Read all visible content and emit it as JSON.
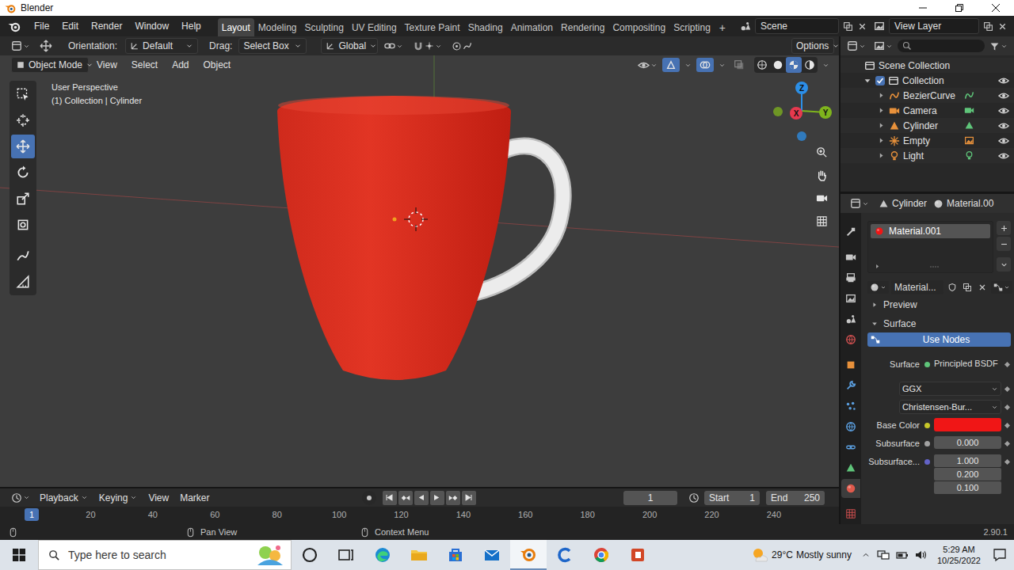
{
  "window": {
    "title": "Blender"
  },
  "menu": [
    "File",
    "Edit",
    "Render",
    "Window",
    "Help"
  ],
  "workspaces": [
    {
      "label": "Layout",
      "selected": true
    },
    {
      "label": "Modeling",
      "selected": false
    },
    {
      "label": "Sculpting",
      "selected": false
    },
    {
      "label": "UV Editing",
      "selected": false
    },
    {
      "label": "Texture Paint",
      "selected": false
    },
    {
      "label": "Shading",
      "selected": false
    },
    {
      "label": "Animation",
      "selected": false
    },
    {
      "label": "Rendering",
      "selected": false
    },
    {
      "label": "Compositing",
      "selected": false
    },
    {
      "label": "Scripting",
      "selected": false
    }
  ],
  "add_workspace": "+",
  "scene": "Scene",
  "view_layer": "View Layer",
  "viewport": {
    "tool_settings": {
      "orientation_label": "Orientation:",
      "orientation": "Default",
      "drag_label": "Drag:",
      "drag": "Select Box",
      "transform": "Global",
      "options": "Options"
    },
    "mode": "Object Mode",
    "menu": [
      "View",
      "Select",
      "Add",
      "Object"
    ],
    "shading": [
      {
        "kind": "wireframe",
        "selected": false
      },
      {
        "kind": "solid",
        "selected": false
      },
      {
        "kind": "material",
        "selected": true
      },
      {
        "kind": "rendered",
        "selected": false
      }
    ],
    "info": [
      "User Perspective",
      "(1) Collection | Cylinder"
    ],
    "tools": [
      {
        "kind": "select-box",
        "selected": false
      },
      {
        "kind": "cursor3d",
        "selected": false
      },
      {
        "kind": "move",
        "selected": true
      },
      {
        "kind": "rotate",
        "selected": false
      },
      {
        "kind": "scale",
        "selected": false
      },
      {
        "kind": "transform",
        "selected": false
      },
      {
        "kind": "annotate",
        "selected": false
      },
      {
        "kind": "measure",
        "selected": false
      }
    ],
    "gizmo": [
      {
        "label": "X",
        "color": "#e6394f"
      },
      {
        "label": "Y",
        "color": "#7fb41d"
      },
      {
        "label": "Z",
        "color": "#2c8fe8"
      }
    ]
  },
  "timeline": {
    "menu": [
      "Playback",
      "Keying",
      "View",
      "Marker"
    ],
    "current_frame": "1",
    "start_label": "Start",
    "start": "1",
    "end_label": "End",
    "end": "250",
    "ticks": [
      "20",
      "40",
      "60",
      "80",
      "100",
      "120",
      "140",
      "160",
      "180",
      "200",
      "220",
      "240"
    ]
  },
  "outliner": {
    "root": "Scene Collection",
    "collection": {
      "name": "Collection",
      "checked": true,
      "expanded": true
    },
    "items": [
      {
        "name": "BezierCurve",
        "kind": "curve",
        "visible": true,
        "expanded": false
      },
      {
        "name": "Camera",
        "kind": "camera",
        "visible": true,
        "expanded": false
      },
      {
        "name": "Cylinder",
        "kind": "mesh",
        "visible": true,
        "expanded": false
      },
      {
        "name": "Empty",
        "kind": "empty",
        "visible": true,
        "expanded": false
      },
      {
        "name": "Light",
        "kind": "light",
        "visible": true,
        "expanded": false
      }
    ]
  },
  "properties": {
    "object": "Cylinder",
    "material": "Material.00",
    "tabs": [
      {
        "kind": "tool",
        "selected": false
      },
      {
        "kind": "render",
        "selected": false
      },
      {
        "kind": "output",
        "selected": false
      },
      {
        "kind": "view-layer",
        "selected": false
      },
      {
        "kind": "scene",
        "selected": false
      },
      {
        "kind": "world",
        "selected": false
      },
      {
        "kind": "object",
        "selected": false
      },
      {
        "kind": "modifier",
        "selected": false
      },
      {
        "kind": "particles",
        "selected": false
      },
      {
        "kind": "physics",
        "selected": false
      },
      {
        "kind": "constraints",
        "selected": false
      },
      {
        "kind": "data",
        "selected": false
      },
      {
        "kind": "material",
        "selected": true
      },
      {
        "kind": "texture",
        "selected": false
      }
    ],
    "slots": [
      {
        "name": "Material.001",
        "selected": true
      }
    ],
    "datablock": "Material...",
    "panels": [
      {
        "label": "Preview",
        "expanded": false
      },
      {
        "label": "Surface",
        "expanded": true
      }
    ],
    "use_nodes": {
      "label": "Use Nodes",
      "on": true
    },
    "rows": [
      {
        "kind": "shader",
        "label": "Surface",
        "value": "Principled BSDF"
      },
      {
        "kind": "enum",
        "value": "GGX"
      },
      {
        "kind": "enum",
        "value": "Christensen-Bur..."
      },
      {
        "kind": "color",
        "label": "Base Color",
        "color": "#f01616"
      },
      {
        "kind": "number",
        "label": "Subsurface",
        "value": "0.000"
      },
      {
        "kind": "vector",
        "label": "Subsurface...",
        "values": [
          "1.000",
          "0.200",
          "0.100"
        ]
      }
    ]
  },
  "status_bar": {
    "hints": [
      "Pan View",
      "Context Menu"
    ],
    "version": "2.90.1"
  },
  "taskbar": {
    "search_placeholder": "Type here to search",
    "apps": [
      {
        "kind": "cortana",
        "active": false
      },
      {
        "kind": "task-view",
        "active": false
      },
      {
        "kind": "edge",
        "active": false
      },
      {
        "kind": "explorer",
        "active": false
      },
      {
        "kind": "store",
        "active": false
      },
      {
        "kind": "mail",
        "active": false
      },
      {
        "kind": "blender",
        "active": true
      },
      {
        "kind": "c-app",
        "active": false
      },
      {
        "kind": "chrome",
        "active": false
      },
      {
        "kind": "office",
        "active": false
      }
    ],
    "temperature": "29°C",
    "weather": "Mostly sunny",
    "time": "5:29 AM",
    "date": "10/25/2022"
  }
}
